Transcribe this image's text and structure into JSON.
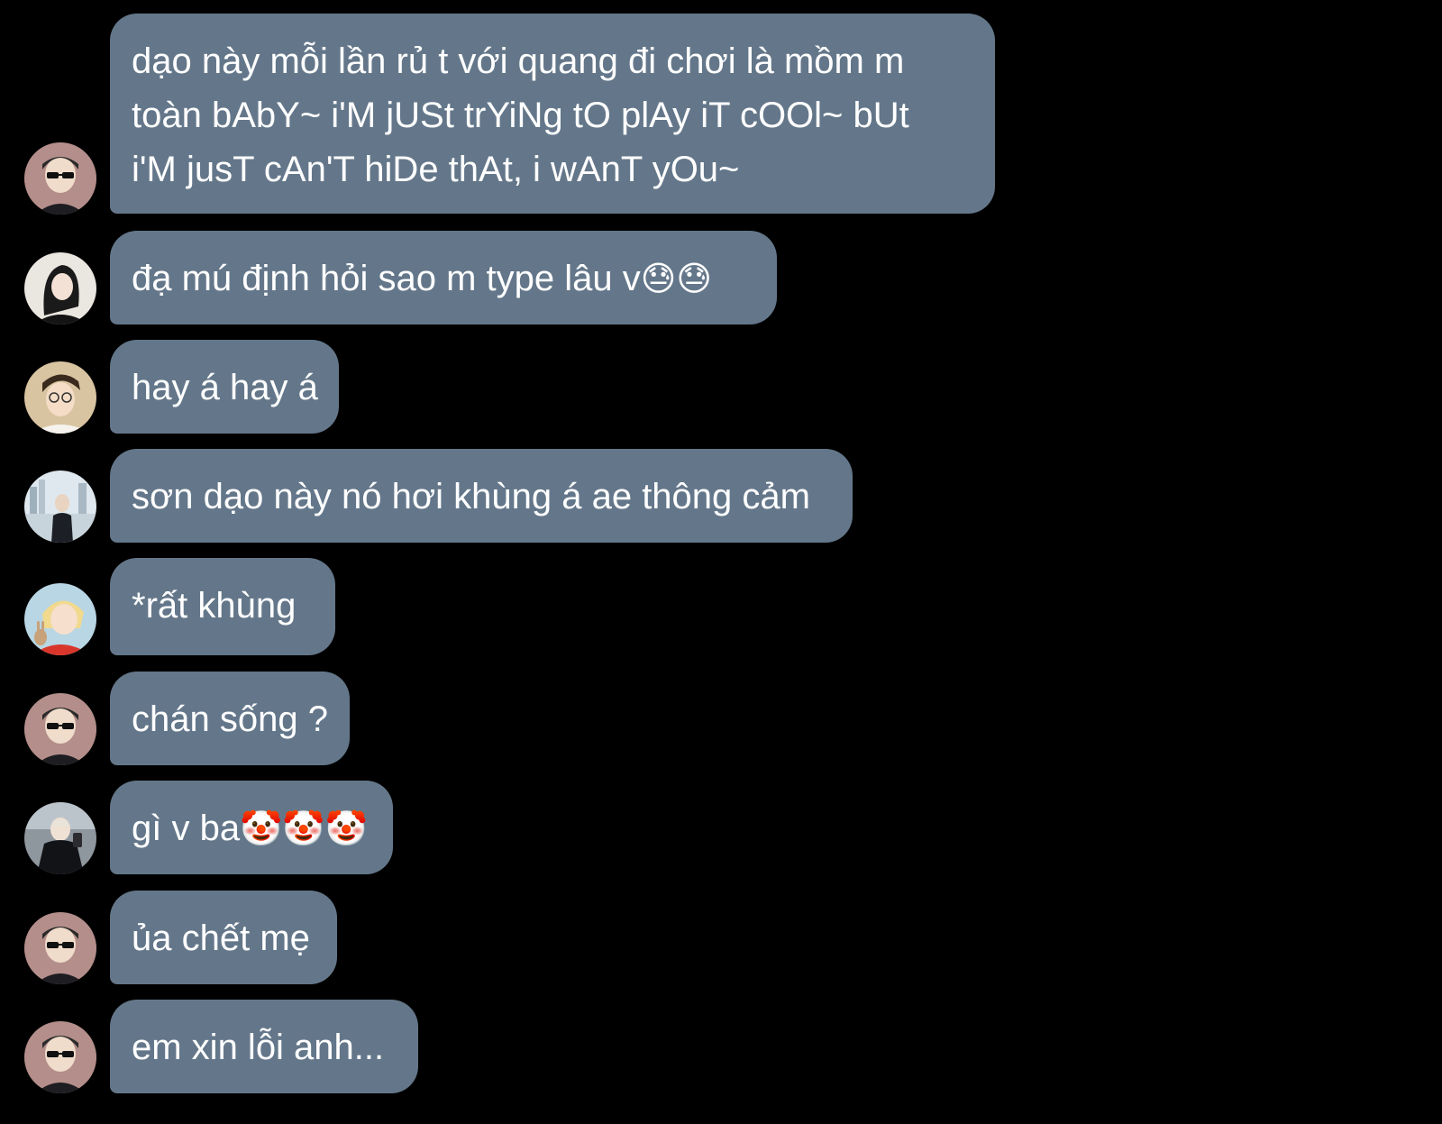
{
  "colors": {
    "background": "#000000",
    "bubble": "#64778a",
    "text": "#ffffff"
  },
  "messages": [
    {
      "avatar": "avatar-sunglasses",
      "lines": [
        "dạo này mỗi lần rủ t với quang đi chơi là mồm m",
        "toàn bAbY~ i'M jUSt trYiNg tO plAy iT cOOl~ bUt",
        "i'M jusT cAn'T hiDe thAt, i wAnT yOu~"
      ]
    },
    {
      "avatar": "avatar-dark-hair",
      "text": "đạ mú định hỏi sao m type lâu v",
      "emoji": "😓😓"
    },
    {
      "avatar": "avatar-glasses",
      "text": "hay á hay á"
    },
    {
      "avatar": "avatar-harbor",
      "text": "sơn dạo này nó hơi khùng á ae thông cảm"
    },
    {
      "avatar": "avatar-blonde-rabbit",
      "text": "*rất khùng"
    },
    {
      "avatar": "avatar-sunglasses",
      "text": "chán sống ?"
    },
    {
      "avatar": "avatar-mirror-selfie",
      "text": "gì v ba",
      "emoji": "🤡🤡🤡"
    },
    {
      "avatar": "avatar-sunglasses",
      "text": "ủa chết mẹ"
    },
    {
      "avatar": "avatar-sunglasses",
      "text": "em xin lỗi anh..."
    }
  ]
}
